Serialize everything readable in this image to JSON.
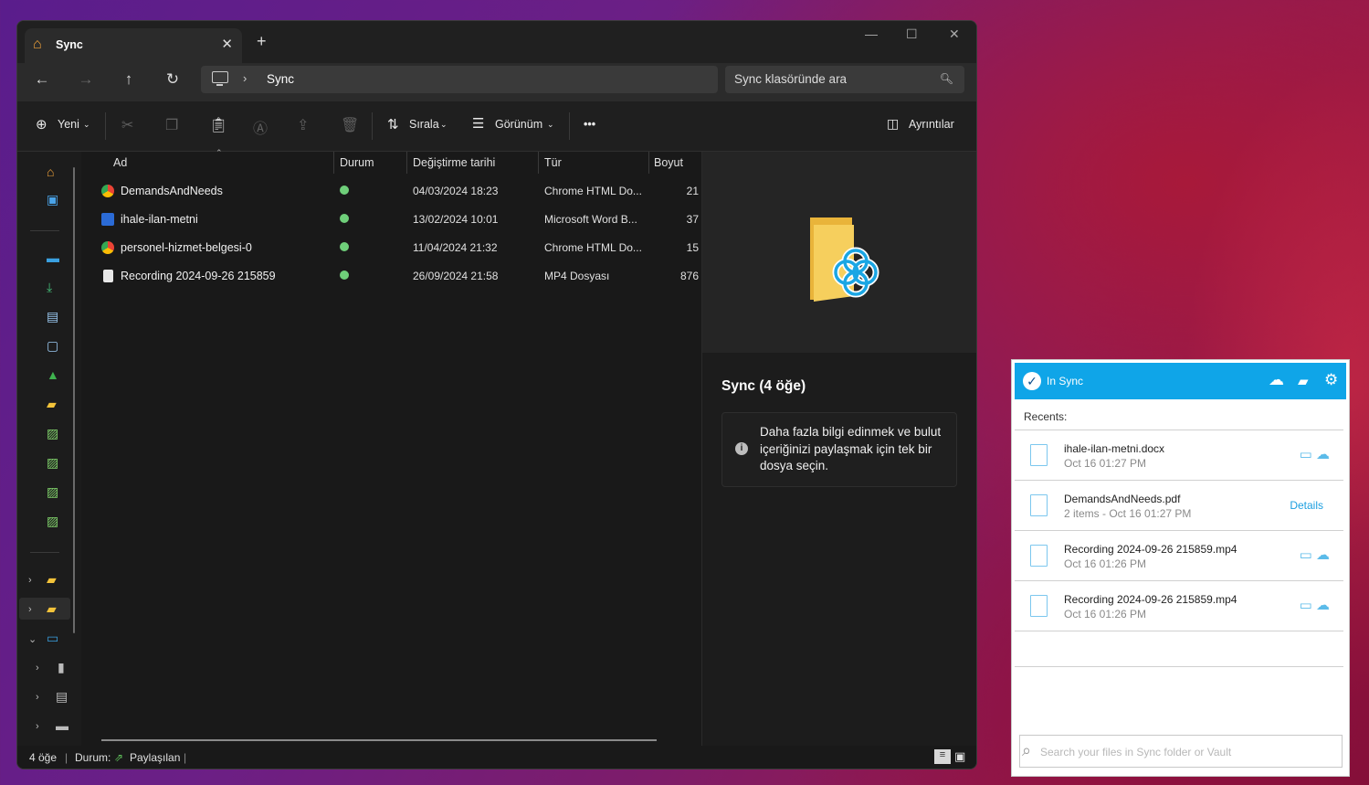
{
  "explorer": {
    "tab_title": "Sync",
    "new_tab": "+",
    "window_controls": {
      "minimize": "—",
      "maximize": "☐",
      "close": "✕"
    },
    "address_path": "Sync",
    "search_placeholder": "Sync klasöründe ara",
    "toolbar": {
      "new_label": "Yeni",
      "sort_label": "Sırala",
      "view_label": "Görünüm",
      "more_label": "•••",
      "details_label": "Ayrıntılar"
    },
    "columns": [
      "Ad",
      "Durum",
      "Değiştirme tarihi",
      "Tür",
      "Boyut"
    ],
    "files": [
      {
        "name": "DemandsAndNeeds",
        "icon": "chrome-icon",
        "date": "04/03/2024 18:23",
        "type": "Chrome HTML Do...",
        "size": "21"
      },
      {
        "name": "ihale-ilan-metni",
        "icon": "word-icon",
        "date": "13/02/2024 10:01",
        "type": "Microsoft Word B...",
        "size": "37"
      },
      {
        "name": "personel-hizmet-belgesi-0",
        "icon": "chrome-icon",
        "date": "11/04/2024 21:32",
        "type": "Chrome HTML Do...",
        "size": "15"
      },
      {
        "name": "Recording 2024-09-26 215859",
        "icon": "video-icon",
        "date": "26/09/2024 21:58",
        "type": "MP4 Dosyası",
        "size": "876"
      }
    ],
    "details_pane": {
      "title": "Sync (4 öğe)",
      "info": "Daha fazla bilgi edinmek ve bulut içeriğinizi paylaşmak için tek bir dosya seçin."
    },
    "statusbar": {
      "count": "4 öğe",
      "status_label": "Durum:",
      "status_value": "Paylaşılan"
    }
  },
  "sync_panel": {
    "status": "In Sync",
    "recents_label": "Recents:",
    "items": [
      {
        "file": "ihale-ilan-metni.docx",
        "meta": "Oct 16 01:27 PM",
        "action": "icons"
      },
      {
        "file": "DemandsAndNeeds.pdf",
        "meta": "2 items - Oct 16 01:27 PM",
        "action": "Details"
      },
      {
        "file": "Recording 2024-09-26 215859.mp4",
        "meta": "Oct 16 01:26 PM",
        "action": "icons"
      },
      {
        "file": "Recording 2024-09-26 215859.mp4",
        "meta": "Oct 16 01:26 PM",
        "action": "icons"
      }
    ],
    "search_placeholder": "Search your files in Sync folder or Vault",
    "colors": {
      "header": "#0fa5e8",
      "accent": "#5bbbe9"
    }
  }
}
